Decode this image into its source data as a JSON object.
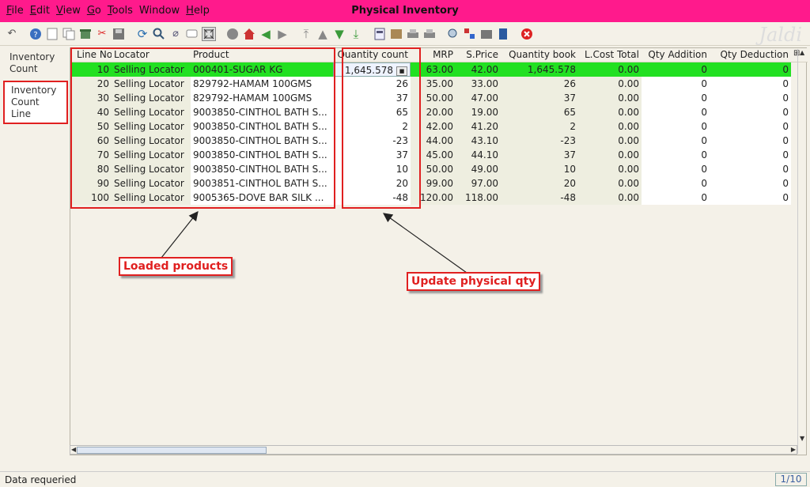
{
  "window": {
    "title": "Physical Inventory"
  },
  "menu": [
    {
      "ul": "F",
      "rest": "ile"
    },
    {
      "ul": "E",
      "rest": "dit"
    },
    {
      "ul": "V",
      "rest": "iew"
    },
    {
      "ul": "G",
      "rest": "o"
    },
    {
      "ul": "T",
      "rest": "ools"
    },
    {
      "ul": "",
      "rest": "Window"
    },
    {
      "ul": "H",
      "rest": "elp"
    }
  ],
  "logo_text": "Jaldi",
  "tabs": [
    "Inventory Count",
    "Inventory Count Line"
  ],
  "columns": [
    "Line No",
    "Locator",
    "Product",
    "Quantity count",
    "MRP",
    "S.Price",
    "Quantity book",
    "L.Cost Total",
    "Qty Addition",
    "Qty Deduction"
  ],
  "rows": [
    {
      "line": "10",
      "locator": "Selling Locator",
      "product": "000401-SUGAR KG",
      "qty_count": "1,645.578",
      "mrp": "63.00",
      "sprice": "42.00",
      "qty_book": "1,645.578",
      "lcost": "0.00",
      "qty_add": "0",
      "qty_ded": "0"
    },
    {
      "line": "20",
      "locator": "Selling Locator",
      "product": "829792-HAMAM 100GMS",
      "qty_count": "26",
      "mrp": "35.00",
      "sprice": "33.00",
      "qty_book": "26",
      "lcost": "0.00",
      "qty_add": "0",
      "qty_ded": "0"
    },
    {
      "line": "30",
      "locator": "Selling Locator",
      "product": "829792-HAMAM 100GMS",
      "qty_count": "37",
      "mrp": "50.00",
      "sprice": "47.00",
      "qty_book": "37",
      "lcost": "0.00",
      "qty_add": "0",
      "qty_ded": "0"
    },
    {
      "line": "40",
      "locator": "Selling Locator",
      "product": "9003850-CINTHOL BATH S...",
      "qty_count": "65",
      "mrp": "20.00",
      "sprice": "19.00",
      "qty_book": "65",
      "lcost": "0.00",
      "qty_add": "0",
      "qty_ded": "0"
    },
    {
      "line": "50",
      "locator": "Selling Locator",
      "product": "9003850-CINTHOL BATH S...",
      "qty_count": "2",
      "mrp": "42.00",
      "sprice": "41.20",
      "qty_book": "2",
      "lcost": "0.00",
      "qty_add": "0",
      "qty_ded": "0"
    },
    {
      "line": "60",
      "locator": "Selling Locator",
      "product": "9003850-CINTHOL BATH S...",
      "qty_count": "-23",
      "mrp": "44.00",
      "sprice": "43.10",
      "qty_book": "-23",
      "lcost": "0.00",
      "qty_add": "0",
      "qty_ded": "0"
    },
    {
      "line": "70",
      "locator": "Selling Locator",
      "product": "9003850-CINTHOL BATH S...",
      "qty_count": "37",
      "mrp": "45.00",
      "sprice": "44.10",
      "qty_book": "37",
      "lcost": "0.00",
      "qty_add": "0",
      "qty_ded": "0"
    },
    {
      "line": "80",
      "locator": "Selling Locator",
      "product": "9003850-CINTHOL BATH S...",
      "qty_count": "10",
      "mrp": "50.00",
      "sprice": "49.00",
      "qty_book": "10",
      "lcost": "0.00",
      "qty_add": "0",
      "qty_ded": "0"
    },
    {
      "line": "90",
      "locator": "Selling Locator",
      "product": "9003851-CINTHOL BATH S...",
      "qty_count": "20",
      "mrp": "99.00",
      "sprice": "97.00",
      "qty_book": "20",
      "lcost": "0.00",
      "qty_add": "0",
      "qty_ded": "0"
    },
    {
      "line": "100",
      "locator": "Selling Locator",
      "product": "9005365-DOVE BAR SILK ...",
      "qty_count": "-48",
      "mrp": "120.00",
      "sprice": "118.00",
      "qty_book": "-48",
      "lcost": "0.00",
      "qty_add": "0",
      "qty_ded": "0"
    }
  ],
  "annotations": {
    "loaded": "Loaded products",
    "update": "Update physical qty"
  },
  "status": {
    "text": "Data requeried",
    "record": "1/10"
  },
  "colors": {
    "titlebar": "#ff1a8c",
    "selected_row": "#22e022",
    "annotation": "#e02020"
  }
}
